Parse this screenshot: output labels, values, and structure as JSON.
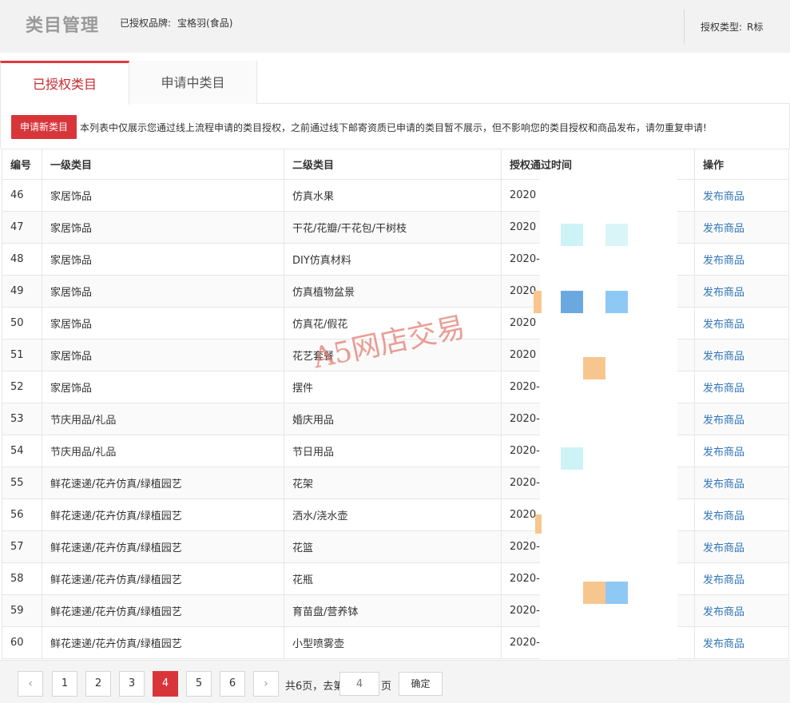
{
  "header": {
    "title": "类目管理",
    "brand_label": "已授权品牌:",
    "brand_value": "宝格羽(食品)",
    "auth_type_label": "授权类型:",
    "auth_type_value": "R标"
  },
  "tabs": [
    {
      "label": "已授权类目",
      "active": true
    },
    {
      "label": "申请中类目",
      "active": false
    }
  ],
  "notice": {
    "apply_button": "申请新类目",
    "text": "本列表中仅展示您通过线上流程申请的类目授权，之前通过线下邮寄资质已申请的类目暂不展示，但不影响您的类目授权和商品发布，请勿重复申请!"
  },
  "table": {
    "headers": [
      "编号",
      "一级类目",
      "二级类目",
      "授权通过时间",
      "操作"
    ],
    "rows": [
      {
        "id": "46",
        "cat1": "家居饰品",
        "cat2": "仿真水果",
        "time": "2020",
        "action": "发布商品"
      },
      {
        "id": "47",
        "cat1": "家居饰品",
        "cat2": "干花/花瓣/干花包/干树枝",
        "time": "2020",
        "action": "发布商品"
      },
      {
        "id": "48",
        "cat1": "家居饰品",
        "cat2": "DIY仿真材料",
        "time": "2020-",
        "action": "发布商品"
      },
      {
        "id": "49",
        "cat1": "家居饰品",
        "cat2": "仿真植物盆景",
        "time": "2020",
        "action": "发布商品"
      },
      {
        "id": "50",
        "cat1": "家居饰品",
        "cat2": "仿真花/假花",
        "time": "2020",
        "action": "发布商品"
      },
      {
        "id": "51",
        "cat1": "家居饰品",
        "cat2": "花艺套餐",
        "time": "2020",
        "action": "发布商品"
      },
      {
        "id": "52",
        "cat1": "家居饰品",
        "cat2": "摆件",
        "time": "2020-",
        "action": "发布商品"
      },
      {
        "id": "53",
        "cat1": "节庆用品/礼品",
        "cat2": "婚庆用品",
        "time": "2020-",
        "action": "发布商品"
      },
      {
        "id": "54",
        "cat1": "节庆用品/礼品",
        "cat2": "节日用品",
        "time": "2020-",
        "action": "发布商品"
      },
      {
        "id": "55",
        "cat1": "鲜花速递/花卉仿真/绿植园艺",
        "cat2": "花架",
        "time": "2020-",
        "action": "发布商品"
      },
      {
        "id": "56",
        "cat1": "鲜花速递/花卉仿真/绿植园艺",
        "cat2": "洒水/浇水壶",
        "time": "2020-",
        "action": "发布商品"
      },
      {
        "id": "57",
        "cat1": "鲜花速递/花卉仿真/绿植园艺",
        "cat2": "花篮",
        "time": "2020-",
        "action": "发布商品"
      },
      {
        "id": "58",
        "cat1": "鲜花速递/花卉仿真/绿植园艺",
        "cat2": "花瓶",
        "time": "2020-",
        "action": "发布商品"
      },
      {
        "id": "59",
        "cat1": "鲜花速递/花卉仿真/绿植园艺",
        "cat2": "育苗盘/营养钵",
        "time": "2020-",
        "action": "发布商品"
      },
      {
        "id": "60",
        "cat1": "鲜花速递/花卉仿真/绿植园艺",
        "cat2": "小型喷雾壶",
        "time": "2020-1",
        "action": "发布商品"
      }
    ]
  },
  "watermark": "A5网店交易",
  "pagination": {
    "prev": "‹",
    "next": "›",
    "pages": [
      "1",
      "2",
      "3",
      "4",
      "5",
      "6"
    ],
    "current": "4",
    "total_text": "共6页，去第",
    "input_value": "4",
    "page_suffix": "页",
    "confirm": "确定"
  },
  "colors": {
    "accent": "#d8353a",
    "link": "#2f74b9",
    "mask_blocks": [
      "#cdf3f7",
      "#6aa9e0",
      "#8ec8f5",
      "#f7c68e"
    ]
  }
}
